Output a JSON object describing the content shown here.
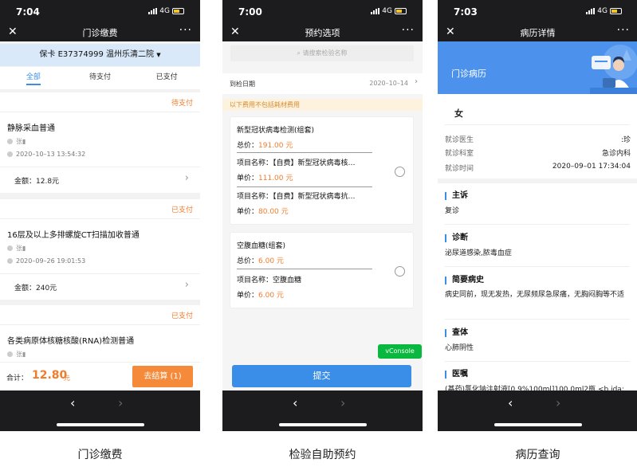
{
  "phones": {
    "p1": {
      "time": "7:04",
      "net": "4G",
      "title": "门诊缴费",
      "card": "保卡 E37374999 温州乐清二院",
      "tabs": [
        "全部",
        "待支付",
        "已支付"
      ],
      "orders": [
        {
          "status": "待支付",
          "name": "静脉采血普通",
          "person": "张▮",
          "date": "2020–10–13 13:54:32",
          "amount": "金额：12.8元"
        },
        {
          "status": "已支付",
          "name": "16层及以上多排螺旋CT扫描加收普通",
          "person": "张▮",
          "date": "2020–09–26 19:01:53",
          "amount": "金额：240元"
        },
        {
          "status": "已支付",
          "name": "各类病原体核糖核酸(RNA)检测普通",
          "person": "张▮",
          "date": "",
          "amount": ""
        }
      ],
      "total_label": "合计：",
      "total": "12.80",
      "total_unit": "元",
      "checkout": "去结算 (1)",
      "caption": "门诊缴费"
    },
    "p2": {
      "time": "7:00",
      "net": "4G",
      "title": "预约选项",
      "search_placeholder": "请搜索检验名称",
      "date_label": "到检日期",
      "date_value": "2020–10–14",
      "notice": "以下费用不包括耗材费用",
      "packages": [
        {
          "name": "新型冠状病毒检测(组套)",
          "price_label": "总价：",
          "price": "191.00 元",
          "items": [
            {
              "name_label": "项目名称：",
              "name": "【自费】新型冠状病毒核…",
              "unit_label": "单价：",
              "unit": "111.00 元"
            },
            {
              "name_label": "项目名称：",
              "name": "【自费】新型冠状病毒抗…",
              "unit_label": "单价：",
              "unit": "80.00 元"
            }
          ]
        },
        {
          "name": "空腹血糖(组套)",
          "price_label": "总价：",
          "price": "6.00 元",
          "items": [
            {
              "name_label": "项目名称：",
              "name": "空腹血糖",
              "unit_label": "单价：",
              "unit": "6.00 元"
            }
          ]
        }
      ],
      "vconsole": "vConsole",
      "submit": "提交",
      "caption": "检验自助预约"
    },
    "p3": {
      "time": "7:03",
      "net": "4G",
      "title": "病历详情",
      "banner": "门诊病历",
      "patient": "女",
      "fields": [
        {
          "k": "就诊医生",
          "v": ":珍"
        },
        {
          "k": "就诊科室",
          "v": "急诊内科"
        },
        {
          "k": "就诊时间",
          "v": "2020–09–01 17:34:04"
        }
      ],
      "sections": [
        {
          "h": "主诉",
          "body": "复诊"
        },
        {
          "h": "诊断",
          "body": "泌尿道感染,脓毒血症"
        },
        {
          "h": "简要病史",
          "body": "病史同前，现无发热，无尿频尿急尿痛，无胸闷胸等不适"
        },
        {
          "h": "查体",
          "body": "心肺阴性"
        },
        {
          "h": "医嘱",
          "body": "(基药)氯化钠注射液[0.9%100ml]100.0ml2瓶 <b  ida:"
        }
      ],
      "caption": "病历查询"
    }
  }
}
